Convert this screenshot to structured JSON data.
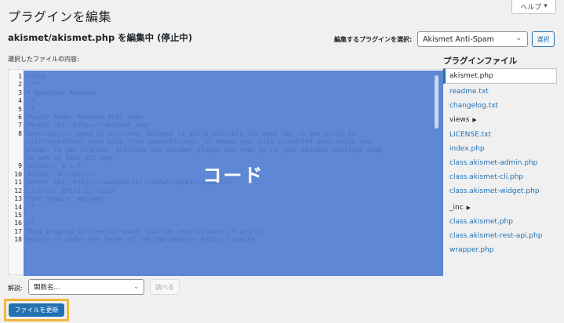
{
  "page": {
    "title": "プラグインを編集",
    "help_label": "ヘルプ"
  },
  "header": {
    "editing_file": "akismet/akismet.php を編集中 (停止中)",
    "select_label": "編集するプラグインを選択:",
    "selected_plugin": "Akismet Anti-Spam",
    "select_button": "選択"
  },
  "editor": {
    "content_label": "選択したファイルの内容:",
    "overlay_label": "コード",
    "lines": [
      {
        "n": "1",
        "t": "<?php"
      },
      {
        "n": "2",
        "t": "/**"
      },
      {
        "n": "3",
        "t": " * @package Akismet"
      },
      {
        "n": "4",
        "t": " */"
      },
      {
        "n": "5",
        "t": "/*"
      },
      {
        "n": "6",
        "t": "Plugin Name: Akismet Anti-Spam"
      },
      {
        "n": "7",
        "t": "Plugin URI: https://akismet.com/"
      },
      {
        "n": "8",
        "t": "Description: Used by millions, Akismet is quite possibly the best way in the world to"
      },
      {
        "n": "",
        "t": "<strong>protect your blog from spam</strong>. It keeps your site protected even while you"
      },
      {
        "n": "",
        "t": "sleep. To get started: activate the Akismet plugin and then go to your Akismet Settings page"
      },
      {
        "n": "",
        "t": "to set up your API key."
      },
      {
        "n": "9",
        "t": "Version: 4.1.9"
      },
      {
        "n": "10",
        "t": "Author: Automattic"
      },
      {
        "n": "11",
        "t": "Author URI: https://automattic.com/wordpress-plugins/"
      },
      {
        "n": "12",
        "t": "License: GPLv2 or later"
      },
      {
        "n": "13",
        "t": "Text Domain: akismet"
      },
      {
        "n": "14",
        "t": "*/"
      },
      {
        "n": "15",
        "t": ""
      },
      {
        "n": "16",
        "t": "/*"
      },
      {
        "n": "17",
        "t": "This program is free software; you can redistribute it and/or"
      },
      {
        "n": "18",
        "t": "modify it under the terms of the GNU General Public License"
      }
    ]
  },
  "files": {
    "title": "プラグインファイル",
    "items": [
      {
        "label": "akismet.php",
        "kind": "active"
      },
      {
        "label": "readme.txt",
        "kind": "file"
      },
      {
        "label": "changelog.txt",
        "kind": "file"
      },
      {
        "label": "views",
        "kind": "folder"
      },
      {
        "label": "LICENSE.txt",
        "kind": "file"
      },
      {
        "label": "index.php",
        "kind": "file"
      },
      {
        "label": "class.akismet-admin.php",
        "kind": "file"
      },
      {
        "label": "class.akismet-cli.php",
        "kind": "file"
      },
      {
        "label": "class.akismet-widget.php",
        "kind": "file"
      },
      {
        "label": "_inc",
        "kind": "folder"
      },
      {
        "label": "class.akismet.php",
        "kind": "file"
      },
      {
        "label": "class.akismet-rest-api.php",
        "kind": "file"
      },
      {
        "label": "wrapper.php",
        "kind": "file"
      }
    ]
  },
  "footer": {
    "doc_label": "解説:",
    "doc_placeholder": "関数名...",
    "lookup_button": "調べる",
    "update_button": "ファイルを更新"
  },
  "colors": {
    "accent": "#2271b1",
    "overlay": "#4876ce",
    "highlight_border": "#f2b63a"
  }
}
